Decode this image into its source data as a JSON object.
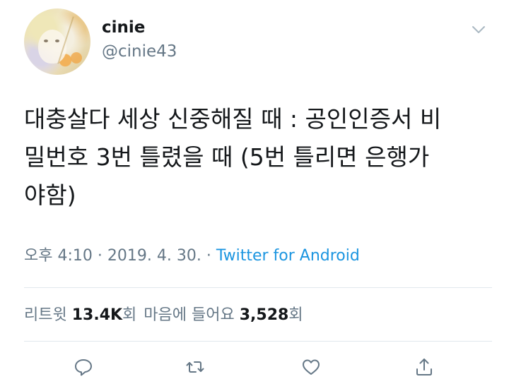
{
  "author": {
    "display_name": "cinie",
    "handle": "@cinie43"
  },
  "tweet": {
    "lines": [
      "대충살다 세상 신중해질 때 : 공인인증서 비",
      "밀번호 3번 틀렸을 때 (5번 틀리면 은행가",
      "야함)"
    ]
  },
  "meta": {
    "time": "오후 4:10",
    "sep1": " · ",
    "date": "2019. 4. 30.",
    "sep2": " · ",
    "source": "Twitter for Android"
  },
  "stats": {
    "retweets_label": "리트윗 ",
    "retweets_count": "13.4K",
    "retweets_unit": "회",
    "likes_label": "마음에 들어요 ",
    "likes_count": "3,528",
    "likes_unit": "회"
  },
  "icons": {
    "reply": "reply-icon",
    "retweet": "retweet-icon",
    "like": "heart-icon",
    "share": "share-icon",
    "menu": "chevron-down-icon"
  },
  "colors": {
    "text": "#14171a",
    "secondary": "#657786",
    "link": "#1b95e0",
    "divider": "#e1e8ed"
  }
}
